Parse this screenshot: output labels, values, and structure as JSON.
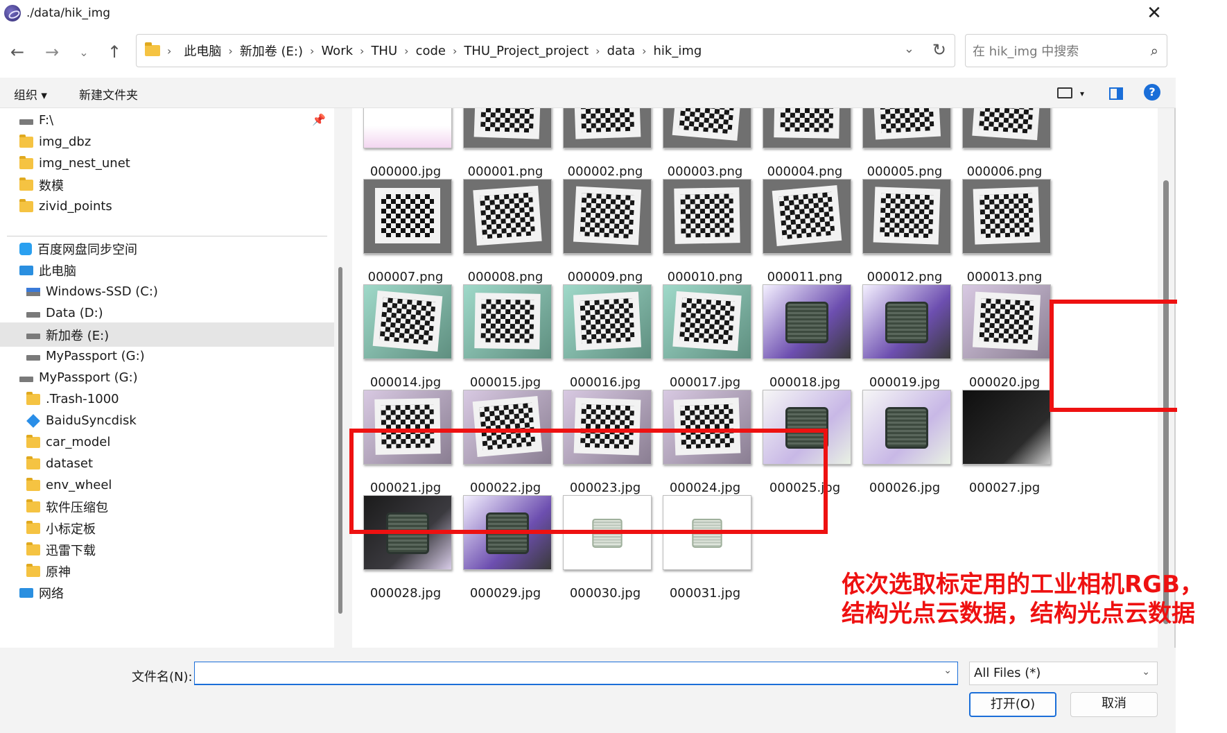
{
  "window": {
    "title": "./data/hik_img",
    "close_glyph": "✕"
  },
  "nav": {
    "back_glyph": "←",
    "forward_glyph": "→",
    "recent_glyph": "⌄",
    "up_glyph": "↑",
    "breadcrumbs": [
      "此电脑",
      "新加卷 (E:)",
      "Work",
      "THU",
      "code",
      "THU_Project_project",
      "data",
      "hik_img"
    ],
    "sep": "›",
    "search_placeholder": "在 hik_img 中搜索"
  },
  "toolbar": {
    "organize": "组织 ▾",
    "new_folder": "新建文件夹",
    "help": "?"
  },
  "sidebar": {
    "items": [
      {
        "label": "F:\\",
        "icon": "drive"
      },
      {
        "label": "img_dbz",
        "icon": "folder"
      },
      {
        "label": "img_nest_unet",
        "icon": "folder"
      },
      {
        "label": "数模",
        "icon": "folder"
      },
      {
        "label": "zivid_points",
        "icon": "folder"
      },
      {
        "label": "百度网盘同步空间",
        "icon": "cloud"
      },
      {
        "label": "此电脑",
        "icon": "pc"
      },
      {
        "label": "Windows-SSD (C:)",
        "icon": "drive-win"
      },
      {
        "label": "Data (D:)",
        "icon": "drive"
      },
      {
        "label": "新加卷 (E:)",
        "icon": "drive",
        "selected": true
      },
      {
        "label": "MyPassport (G:)",
        "icon": "drive"
      },
      {
        "label": "MyPassport (G:)",
        "icon": "drive"
      },
      {
        "label": ".Trash-1000",
        "icon": "folder"
      },
      {
        "label": "BaiduSyncdisk",
        "icon": "baidu"
      },
      {
        "label": "car_model",
        "icon": "folder"
      },
      {
        "label": "dataset",
        "icon": "folder"
      },
      {
        "label": "env_wheel",
        "icon": "folder"
      },
      {
        "label": "软件压缩包",
        "icon": "folder"
      },
      {
        "label": "小标定板",
        "icon": "folder"
      },
      {
        "label": "迅雷下载",
        "icon": "folder"
      },
      {
        "label": "原神",
        "icon": "folder"
      },
      {
        "label": "网络",
        "icon": "pc"
      }
    ]
  },
  "files": [
    {
      "name": "000000.jpg",
      "kind": "blank"
    },
    {
      "name": "000001.png",
      "kind": "checker"
    },
    {
      "name": "000002.png",
      "kind": "checker"
    },
    {
      "name": "000003.png",
      "kind": "checker"
    },
    {
      "name": "000004.png",
      "kind": "checker"
    },
    {
      "name": "000005.png",
      "kind": "checker"
    },
    {
      "name": "000006.png",
      "kind": "checker"
    },
    {
      "name": "000007.png",
      "kind": "checker"
    },
    {
      "name": "000008.png",
      "kind": "checker"
    },
    {
      "name": "000009.png",
      "kind": "checker"
    },
    {
      "name": "000010.png",
      "kind": "checker"
    },
    {
      "name": "000011.png",
      "kind": "checker"
    },
    {
      "name": "000012.png",
      "kind": "checker"
    },
    {
      "name": "000013.png",
      "kind": "checker"
    },
    {
      "name": "000014.jpg",
      "kind": "checker-teal"
    },
    {
      "name": "000015.jpg",
      "kind": "checker-teal"
    },
    {
      "name": "000016.jpg",
      "kind": "checker-teal"
    },
    {
      "name": "000017.jpg",
      "kind": "checker-teal"
    },
    {
      "name": "000018.jpg",
      "kind": "chip-purple"
    },
    {
      "name": "000019.jpg",
      "kind": "chip-purple"
    },
    {
      "name": "000020.jpg",
      "kind": "checker-pink"
    },
    {
      "name": "000021.jpg",
      "kind": "checker-pink"
    },
    {
      "name": "000022.jpg",
      "kind": "checker-pink"
    },
    {
      "name": "000023.jpg",
      "kind": "checker-pink"
    },
    {
      "name": "000024.jpg",
      "kind": "checker-pink"
    },
    {
      "name": "000025.jpg",
      "kind": "chip-light"
    },
    {
      "name": "000026.jpg",
      "kind": "chip-light"
    },
    {
      "name": "000027.jpg",
      "kind": "dark"
    },
    {
      "name": "000028.jpg",
      "kind": "chip-dark"
    },
    {
      "name": "000029.jpg",
      "kind": "chip-purple"
    },
    {
      "name": "000030.jpg",
      "kind": "chip-white"
    },
    {
      "name": "000031.jpg",
      "kind": "chip-white"
    }
  ],
  "annotation": {
    "line1": "依次选取标定用的工业相机RGB，",
    "line2": "结构光点云数据，结构光点云数据",
    "color": "#ee1111"
  },
  "bottom": {
    "filename_label": "文件名(N):",
    "filename_value": "",
    "filetype": "All Files (*)",
    "open_label": "打开(O)",
    "cancel_label": "取消"
  }
}
